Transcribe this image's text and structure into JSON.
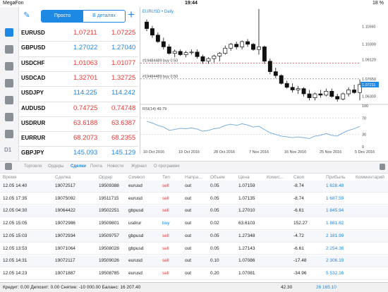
{
  "status_bar": {
    "carrier": "MegaFon",
    "time": "19:44",
    "battery": "18 %"
  },
  "segmented": {
    "simple": "Просто",
    "detailed": "В деталях"
  },
  "quotes": [
    {
      "symbol": "EURUSD",
      "bid": "1.07211",
      "ask": "1.07225",
      "color": "red"
    },
    {
      "symbol": "GBPUSD",
      "bid": "1.27022",
      "ask": "1.27040",
      "color": "blue"
    },
    {
      "symbol": "USDCHF",
      "bid": "1.01063",
      "ask": "1.01077",
      "color": "red"
    },
    {
      "symbol": "USDCAD",
      "bid": "1.32701",
      "ask": "1.32725",
      "color": "red"
    },
    {
      "symbol": "USDJPY",
      "bid": "114.225",
      "ask": "114.242",
      "color": "blue"
    },
    {
      "symbol": "AUDUSD",
      "bid": "0.74725",
      "ask": "0.74748",
      "color": "red"
    },
    {
      "symbol": "USDRUR",
      "bid": "63.6188",
      "ask": "63.6387",
      "color": "red"
    },
    {
      "symbol": "EURRUR",
      "bid": "68.2073",
      "ask": "68.2355",
      "color": "red"
    },
    {
      "symbol": "GBPJPY",
      "bid": "145.093",
      "ask": "145.129",
      "color": "blue"
    }
  ],
  "chart": {
    "title": "EURUSD • Daily",
    "order_label_1": "#19484489 buy 0.50",
    "order_label_2": "#19484489 buy 0.50",
    "indicator_label": "RSI(14) 49.79",
    "price_ticks": [
      "1.11660",
      "1.10300",
      "1.09120",
      "1.07650",
      "1.07211",
      "1.06300"
    ],
    "rsi_ticks": [
      "100",
      "70",
      "30",
      "0"
    ],
    "date_ticks": [
      "10 Oct 2016",
      "19 Oct 2016",
      "28 Oct 2016",
      "7 Nov 2016",
      "16 Nov 2016",
      "25 Nov 2016",
      "5 Dec 2016"
    ],
    "current_price": "1.07211"
  },
  "chart_data": {
    "type": "candlestick",
    "title": "EURUSD • Daily",
    "candles": [
      {
        "o": 1.12,
        "h": 1.122,
        "l": 1.113,
        "c": 1.115
      },
      {
        "o": 1.115,
        "h": 1.117,
        "l": 1.108,
        "c": 1.11
      },
      {
        "o": 1.11,
        "h": 1.112,
        "l": 1.104,
        "c": 1.105
      },
      {
        "o": 1.105,
        "h": 1.108,
        "l": 1.099,
        "c": 1.101
      },
      {
        "o": 1.101,
        "h": 1.103,
        "l": 1.095,
        "c": 1.096
      },
      {
        "o": 1.096,
        "h": 1.099,
        "l": 1.093,
        "c": 1.0975
      },
      {
        "o": 1.0975,
        "h": 1.099,
        "l": 1.094,
        "c": 1.095
      },
      {
        "o": 1.095,
        "h": 1.098,
        "l": 1.093,
        "c": 1.0965
      },
      {
        "o": 1.0965,
        "h": 1.099,
        "l": 1.095,
        "c": 1.097
      },
      {
        "o": 1.097,
        "h": 1.099,
        "l": 1.092,
        "c": 1.0935
      },
      {
        "o": 1.0935,
        "h": 1.095,
        "l": 1.088,
        "c": 1.09
      },
      {
        "o": 1.09,
        "h": 1.093,
        "l": 1.088,
        "c": 1.092
      },
      {
        "o": 1.092,
        "h": 1.095,
        "l": 1.089,
        "c": 1.094
      },
      {
        "o": 1.094,
        "h": 1.097,
        "l": 1.09,
        "c": 1.096
      },
      {
        "o": 1.096,
        "h": 1.102,
        "l": 1.095,
        "c": 1.1
      },
      {
        "o": 1.1,
        "h": 1.104,
        "l": 1.098,
        "c": 1.103
      },
      {
        "o": 1.103,
        "h": 1.105,
        "l": 1.099,
        "c": 1.101
      },
      {
        "o": 1.101,
        "h": 1.106,
        "l": 1.099,
        "c": 1.105
      },
      {
        "o": 1.105,
        "h": 1.107,
        "l": 1.101,
        "c": 1.103
      },
      {
        "o": 1.103,
        "h": 1.104,
        "l": 1.098,
        "c": 1.099
      },
      {
        "o": 1.099,
        "h": 1.13,
        "l": 1.095,
        "c": 1.101
      },
      {
        "o": 1.101,
        "h": 1.102,
        "l": 1.088,
        "c": 1.09
      },
      {
        "o": 1.09,
        "h": 1.092,
        "l": 1.08,
        "c": 1.082
      },
      {
        "o": 1.082,
        "h": 1.085,
        "l": 1.077,
        "c": 1.079
      },
      {
        "o": 1.079,
        "h": 1.08,
        "l": 1.072,
        "c": 1.073
      },
      {
        "o": 1.073,
        "h": 1.075,
        "l": 1.069,
        "c": 1.07
      },
      {
        "o": 1.07,
        "h": 1.073,
        "l": 1.066,
        "c": 1.068
      },
      {
        "o": 1.068,
        "h": 1.071,
        "l": 1.065,
        "c": 1.069
      },
      {
        "o": 1.069,
        "h": 1.07,
        "l": 1.063,
        "c": 1.065
      },
      {
        "o": 1.065,
        "h": 1.068,
        "l": 1.06,
        "c": 1.062
      },
      {
        "o": 1.062,
        "h": 1.066,
        "l": 1.06,
        "c": 1.065
      },
      {
        "o": 1.065,
        "h": 1.068,
        "l": 1.062,
        "c": 1.064
      },
      {
        "o": 1.064,
        "h": 1.069,
        "l": 1.063,
        "c": 1.067
      },
      {
        "o": 1.067,
        "h": 1.069,
        "l": 1.062,
        "c": 1.063
      },
      {
        "o": 1.063,
        "h": 1.065,
        "l": 1.059,
        "c": 1.061
      },
      {
        "o": 1.061,
        "h": 1.066,
        "l": 1.06,
        "c": 1.065
      },
      {
        "o": 1.065,
        "h": 1.07,
        "l": 1.063,
        "c": 1.068
      },
      {
        "o": 1.068,
        "h": 1.072,
        "l": 1.065,
        "c": 1.066
      },
      {
        "o": 1.066,
        "h": 1.076,
        "l": 1.06,
        "c": 1.0721
      }
    ],
    "rsi": [
      62,
      58,
      52,
      48,
      40,
      42,
      45,
      44,
      46,
      43,
      38,
      40,
      44,
      46,
      52,
      55,
      52,
      56,
      53,
      48,
      50,
      42,
      34,
      30,
      26,
      24,
      22,
      24,
      22,
      20,
      26,
      28,
      32,
      28,
      26,
      34,
      40,
      44,
      49.79
    ],
    "ylim": [
      1.058,
      1.125
    ],
    "rsi_ylim": [
      0,
      100
    ]
  },
  "tabs": [
    "Торговля",
    "Ордеры",
    "Сделки",
    "Почта",
    "Новости",
    "Журнал",
    "О программе"
  ],
  "active_tab": "Сделки",
  "table": {
    "headers": [
      "Время",
      "Сделка",
      "Ордер",
      "Символ",
      "Тип",
      "Напра...",
      "Объем",
      "Цена",
      "Комис...",
      "Своп",
      "Прибыль",
      "Комментарий"
    ],
    "rows": [
      [
        "12.05 14:40",
        "19072517",
        "19509388",
        "eurusd",
        "sell",
        "out",
        "0.05",
        "1.07159",
        "",
        "-8.74",
        "1 628.48",
        ""
      ],
      [
        "12.05 17:35",
        "19075092",
        "19511715",
        "eurusd",
        "sell",
        "out",
        "0.05",
        "1.07135",
        "",
        "-8.74",
        "1 687.59",
        ""
      ],
      [
        "12.05 04:30",
        "19064422",
        "19502251",
        "gbpusd",
        "sell",
        "out",
        "0.05",
        "1.27010",
        "",
        "-6.61",
        "1 845.94",
        ""
      ],
      [
        "12.05 15:05",
        "19072986",
        "19509801",
        "usdrur",
        "buy",
        "out",
        "0.02",
        "63.6103",
        "",
        "152.27",
        "1 881.62",
        ""
      ],
      [
        "12.05 15:03",
        "19072934",
        "19509757",
        "gbpusd",
        "sell",
        "out",
        "0.05",
        "1.27348",
        "",
        "-4.72",
        "2 181.99",
        ""
      ],
      [
        "12.05 13:53",
        "19071064",
        "19508028",
        "gbpusd",
        "sell",
        "out",
        "0.05",
        "1.27143",
        "",
        "-6.61",
        "2 254.36",
        ""
      ],
      [
        "12.05 14:31",
        "19072117",
        "19509026",
        "eurusd",
        "sell",
        "out",
        "0.10",
        "1.07086",
        "",
        "-17.48",
        "2 306.19",
        ""
      ],
      [
        "12.05 14:23",
        "19071887",
        "19508785",
        "eurusd",
        "sell",
        "out",
        "0.20",
        "1.07081",
        "",
        "-34.96",
        "5 532.16",
        ""
      ]
    ]
  },
  "footer": {
    "summary": "Кредит: 0.00 Депозит: 0.00 Снятие: -10 000.00 Баланс: 16 207.40",
    "swap_total": "42.30",
    "profit_total": "26 165.10"
  },
  "colors": {
    "accent": "#1e88e5",
    "sell": "#e53935",
    "buy": "#1e88e5",
    "rsi_line": "#6fa8dc"
  }
}
